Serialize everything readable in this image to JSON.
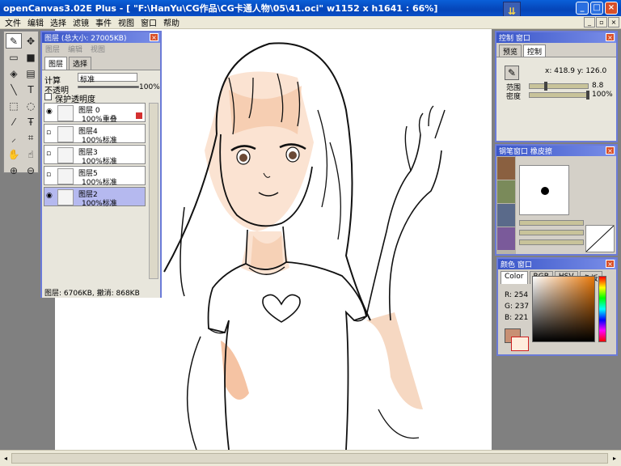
{
  "window": {
    "title": "openCanvas3.02E Plus - [ \"F:\\HanYu\\CG作品\\CG卡通人物\\05\\41.oci\" w1152 x h1641 : 66%]",
    "buttons": {
      "minimize": "_",
      "maximize": "□",
      "close": "×"
    }
  },
  "menu": [
    "文件",
    "编辑",
    "选择",
    "滤镜",
    "事件",
    "视图",
    "窗口",
    "帮助"
  ],
  "toolbox": {
    "tools": [
      {
        "name": "pen-tool",
        "glyph": "✎"
      },
      {
        "name": "move-tool",
        "glyph": "✥"
      },
      {
        "name": "rect-select-tool",
        "glyph": "▭"
      },
      {
        "name": "fill-rect-tool",
        "glyph": "■"
      },
      {
        "name": "bucket-tool",
        "glyph": "◈"
      },
      {
        "name": "gradient-tool",
        "glyph": "▤"
      },
      {
        "name": "line-tool",
        "glyph": "╲"
      },
      {
        "name": "text-tool",
        "glyph": "T"
      },
      {
        "name": "marquee-tool",
        "glyph": "⬚"
      },
      {
        "name": "lasso-tool",
        "glyph": "◌"
      },
      {
        "name": "dropper-tool",
        "glyph": "⁄"
      },
      {
        "name": "text-outline-tool",
        "glyph": "Ŧ"
      },
      {
        "name": "eyedropper-tool",
        "glyph": "⸝"
      },
      {
        "name": "crop-tool",
        "glyph": "⌗"
      },
      {
        "name": "hand-tool",
        "glyph": "✋"
      },
      {
        "name": "rotate-hand-tool",
        "glyph": "☝"
      },
      {
        "name": "zoom-in-tool",
        "glyph": "⊕"
      },
      {
        "name": "zoom-out-tool",
        "glyph": "⊖"
      }
    ]
  },
  "layers_panel": {
    "title": "图层 (总大小: 27005KB)",
    "tabs": [
      "图层",
      "选择"
    ],
    "submenu": [
      "图层",
      "编辑",
      "视图"
    ],
    "blend_label": "计算",
    "blend_value": "标准",
    "opacity_label": "不透明",
    "opacity_value": "100%",
    "protect_label": "保护透明度",
    "layers": [
      {
        "name": "图层 0",
        "mode": "100%重叠",
        "visible": true,
        "selected": false,
        "marked": true
      },
      {
        "name": "图层4",
        "mode": "100%标准",
        "visible": false,
        "selected": false,
        "marked": false
      },
      {
        "name": "图层3",
        "mode": "100%标准",
        "visible": false,
        "selected": false,
        "marked": false
      },
      {
        "name": "图层5",
        "mode": "100%标准",
        "visible": false,
        "selected": false,
        "marked": false
      },
      {
        "name": "图层2",
        "mode": "100%标准",
        "visible": true,
        "selected": true,
        "marked": false
      }
    ],
    "footer": "图层: 6706KB, 撤消: 868KB"
  },
  "control_panel": {
    "title": "控制 窗口",
    "tabs": [
      "预览",
      "控制"
    ],
    "coords": "x: 418.9  y: 126.0",
    "range_label": "范围",
    "range_value": "8.8",
    "density_label": "密度",
    "density_value": "100%"
  },
  "pen_panel": {
    "title": "钢笔窗口   橡皮擦"
  },
  "color_panel": {
    "title": "颜色 窗口",
    "tabs": [
      "Color",
      "RGB",
      "HSV",
      "色板"
    ],
    "r": "R: 254",
    "g": "G: 237",
    "b": "B: 221"
  },
  "colors": {
    "skin": "#f6cdb0",
    "line": "#1a1a1a",
    "accent": "#3a56c8"
  }
}
